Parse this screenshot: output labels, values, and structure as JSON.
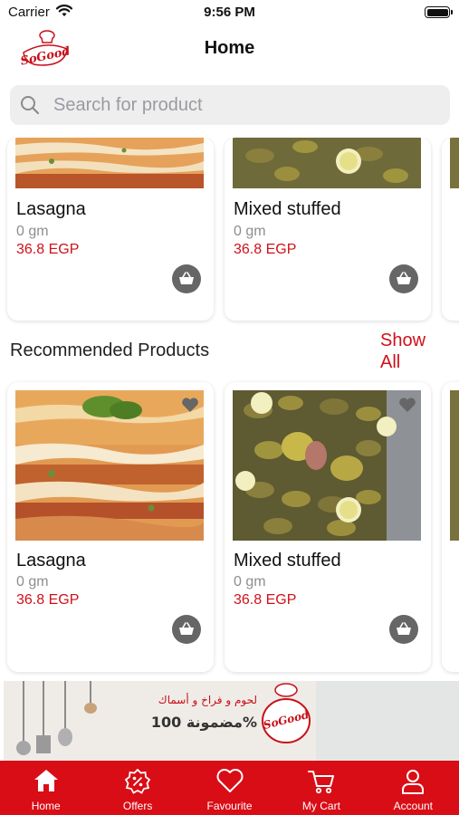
{
  "status_bar": {
    "carrier": "Carrier",
    "time": "9:56 PM"
  },
  "nav": {
    "title": "Home",
    "logo_text": "SoGood"
  },
  "search": {
    "placeholder": "Search for product"
  },
  "colors": {
    "accent": "#d90d16",
    "price": "#d0101a",
    "cart_button": "#666666"
  },
  "top_row": [
    {
      "name": "Lasagna",
      "weight": "0 gm",
      "price": "36.8 EGP"
    },
    {
      "name": "Mixed stuffed",
      "weight": "0 gm",
      "price": "36.8 EGP"
    }
  ],
  "recommended": {
    "title": "Recommended Products",
    "show_all": "Show All",
    "items": [
      {
        "name": "Lasagna",
        "weight": "0 gm",
        "price": "36.8 EGP"
      },
      {
        "name": "Mixed stuffed",
        "weight": "0 gm",
        "price": "36.8 EGP"
      }
    ]
  },
  "banner": {
    "line1": "لحوم و فراخ و أسماك",
    "line2": "مضمونة 100%",
    "logo_text": "SoGood"
  },
  "tabs": [
    {
      "label": "Home",
      "icon": "home-icon"
    },
    {
      "label": "Offers",
      "icon": "offers-icon"
    },
    {
      "label": "Favourite",
      "icon": "heart-icon"
    },
    {
      "label": "My Cart",
      "icon": "cart-icon"
    },
    {
      "label": "Account",
      "icon": "account-icon"
    }
  ]
}
